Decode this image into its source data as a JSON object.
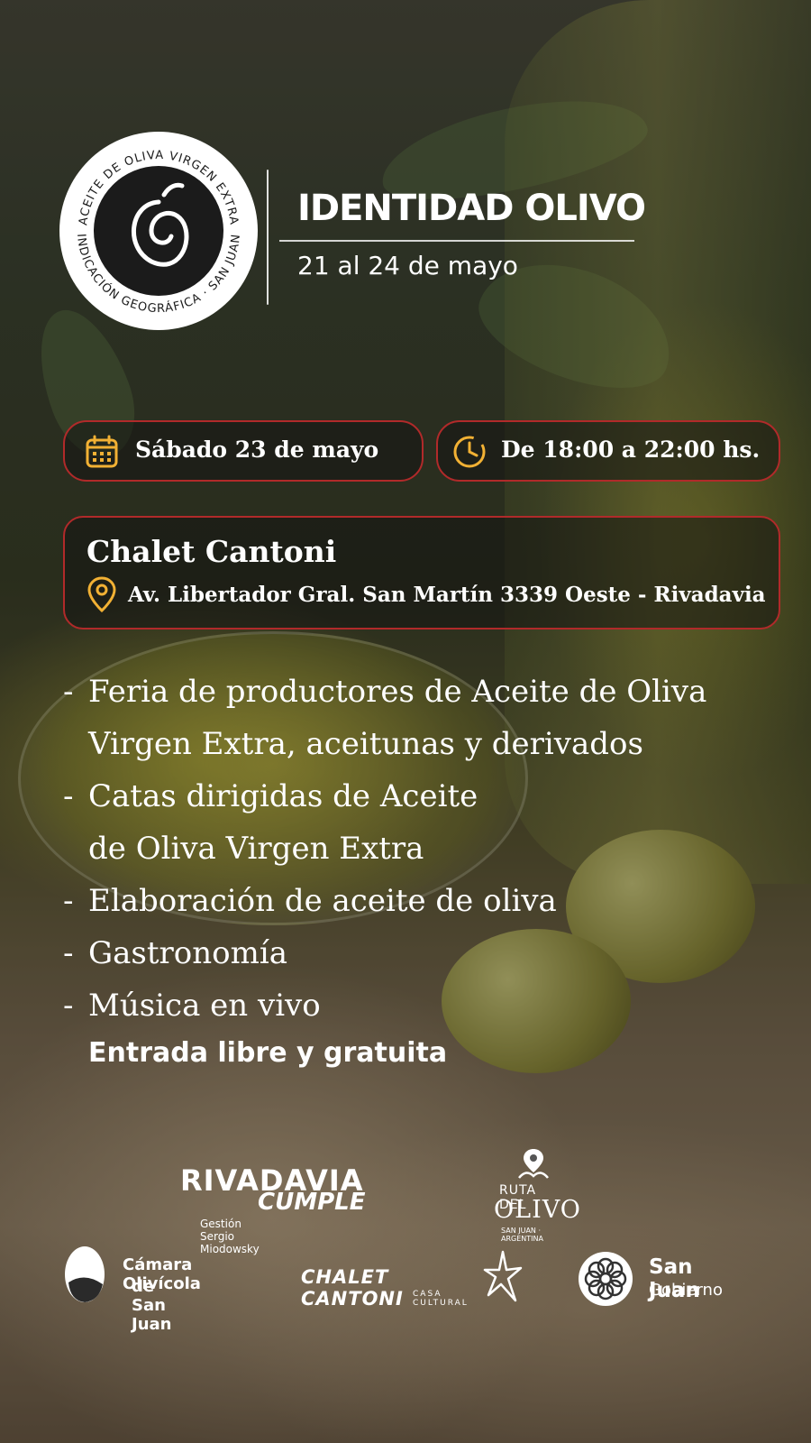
{
  "seal": {
    "top_arc": "· ACEITE DE OLIVA VIRGEN EXTRA ·",
    "bottom_arc": "INDICACIÓN GEOGRÁFICA · SAN JUAN"
  },
  "event": {
    "title": "IDENTIDAD OLIVO",
    "dates": "21 al 24 de mayo",
    "day": "Sábado 23 de mayo",
    "time": "De 18:00 a 22:00 hs.",
    "venue": "Chalet Cantoni",
    "address": "Av. Libertador Gral. San Martín 3339 Oeste - Rivadavia"
  },
  "activities": [
    "Feria de productores de Aceite de Oliva",
    "Virgen Extra, aceitunas y derivados",
    "Catas dirigidas de Aceite",
    "de Oliva Virgen Extra",
    "Elaboración de aceite de oliva",
    "Gastronomía",
    "Música en vivo"
  ],
  "entry": "Entrada libre y gratuita",
  "sponsors": {
    "rivadavia_line1": "RIVADAVIA",
    "rivadavia_line2": "CUMPLE",
    "rivadavia_sub": "Gestión Sergio Miodowsky",
    "ruta_line1": "RUTA DEL",
    "ruta_line2": "OLIVO",
    "ruta_sub": "SAN JUAN · ARGENTINA",
    "camara_line1": "Cámara Olivícola",
    "camara_line2": "de San Juan",
    "chalet_line1": "CHALET CANTONI",
    "chalet_line2": "CASA CULTURAL",
    "sanjuan_line1": "San Juan",
    "sanjuan_line2": "Gobierno"
  },
  "colors": {
    "pill_border": "#b12a2a",
    "icon_gold": "#f2b134",
    "text": "#ffffff"
  },
  "icons": [
    "calendar-icon",
    "clock-icon",
    "location-pin-icon",
    "olive-swirl-icon"
  ]
}
